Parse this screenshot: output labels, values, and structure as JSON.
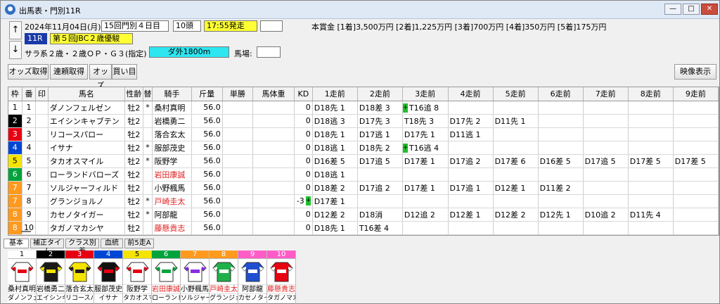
{
  "window": {
    "title": "出馬表・門別11R",
    "min": "—",
    "max": "□",
    "close": "✕"
  },
  "race": {
    "date": "2024年11月04日(月)",
    "meeting": "15回門別４日目",
    "heads": "10頭",
    "start_time": "17:55発走",
    "race_no": "11R",
    "race_name": "第５回JBC２歳優駿",
    "condition": "サラ系２歳・２歳ＯＰ・Ｇ３(指定)",
    "course": "ダ外1800m",
    "baba_label": "馬場:",
    "baba_value": "",
    "blank_box": "",
    "prize": "本賞金 [1着]3,500万円 [2着]1,225万円 [3着]700万円 [4着]350万円 [5着]175万円",
    "up_arrow": "↑",
    "down_arrow": "↓"
  },
  "toolbar": {
    "odds_fetch": "オッズ取得",
    "renpuku_fetch": "連頼取得",
    "odds": "オッズ",
    "buy": "買い目",
    "video": "映像表示"
  },
  "columns": [
    "枠",
    "番",
    "印",
    "馬名",
    "性齢",
    "替",
    "騎手",
    "斤量",
    "単勝",
    "馬体重",
    "KD",
    "1走前",
    "2走前",
    "3走前",
    "4走前",
    "5走前",
    "6走前",
    "7走前",
    "8走前",
    "9走前"
  ],
  "waku_colors": [
    "#ffffff",
    "#000000",
    "#e60012",
    "#0046d5",
    "#f4e400",
    "#00a33c",
    "#ff9a1f",
    "#ff9a1f",
    "#ff5cc8",
    "#ff5cc8"
  ],
  "waku_text_colors": [
    "#000000",
    "#ffffff",
    "#ffffff",
    "#ffffff",
    "#000000",
    "#ffffff",
    "#ffffff",
    "#ffffff",
    "#ffffff",
    "#ffffff"
  ],
  "rows": [
    {
      "waku": "1",
      "num": "1",
      "mark": "",
      "name": "ダノンフェルゼン",
      "sexage": "牡2",
      "change": "*",
      "jockey": "桑村真明",
      "jred": false,
      "weight": "56.0",
      "odds": "",
      "bw": "",
      "kd": "0",
      "kdicon": false,
      "past": [
        {
          "t": "D18先 1",
          "i": false
        },
        {
          "t": "D18差 3",
          "i": false
        },
        {
          "t": "T16追 8",
          "i": true
        },
        {
          "t": "",
          "i": false
        },
        {
          "t": "",
          "i": false
        },
        {
          "t": "",
          "i": false
        },
        {
          "t": "",
          "i": false
        },
        {
          "t": "",
          "i": false
        },
        {
          "t": "",
          "i": false
        }
      ]
    },
    {
      "waku": "2",
      "num": "2",
      "mark": "",
      "name": "エイシンキャブテン",
      "sexage": "牡2",
      "change": "",
      "jockey": "岩橋勇二",
      "jred": false,
      "weight": "56.0",
      "odds": "",
      "bw": "",
      "kd": "0",
      "kdicon": false,
      "past": [
        {
          "t": "D18逃 3",
          "i": false
        },
        {
          "t": "D17先 3",
          "i": false
        },
        {
          "t": "T18先 3",
          "i": false
        },
        {
          "t": "D17先 2",
          "i": false
        },
        {
          "t": "D11先 1",
          "i": false
        },
        {
          "t": "",
          "i": false
        },
        {
          "t": "",
          "i": false
        },
        {
          "t": "",
          "i": false
        },
        {
          "t": "",
          "i": false
        }
      ]
    },
    {
      "waku": "3",
      "num": "3",
      "mark": "",
      "name": "リコースパロー",
      "sexage": "牡2",
      "change": "",
      "jockey": "落合玄太",
      "jred": false,
      "weight": "56.0",
      "odds": "",
      "bw": "",
      "kd": "0",
      "kdicon": false,
      "past": [
        {
          "t": "D18先 1",
          "i": false
        },
        {
          "t": "D17逃 1",
          "i": false
        },
        {
          "t": "D17先 1",
          "i": false
        },
        {
          "t": "D11逃 1",
          "i": false
        },
        {
          "t": "",
          "i": false
        },
        {
          "t": "",
          "i": false
        },
        {
          "t": "",
          "i": false
        },
        {
          "t": "",
          "i": false
        },
        {
          "t": "",
          "i": false
        }
      ]
    },
    {
      "waku": "4",
      "num": "4",
      "mark": "",
      "name": "イサナ",
      "sexage": "牡2",
      "change": "*",
      "jockey": "服部茂史",
      "jred": false,
      "weight": "56.0",
      "odds": "",
      "bw": "",
      "kd": "0",
      "kdicon": false,
      "past": [
        {
          "t": "D18逃 1",
          "i": false
        },
        {
          "t": "D18先 2",
          "i": false
        },
        {
          "t": "T16逃 4",
          "i": true
        },
        {
          "t": "",
          "i": false
        },
        {
          "t": "",
          "i": false
        },
        {
          "t": "",
          "i": false
        },
        {
          "t": "",
          "i": false
        },
        {
          "t": "",
          "i": false
        },
        {
          "t": "",
          "i": false
        }
      ]
    },
    {
      "waku": "5",
      "num": "5",
      "mark": "",
      "name": "タカオスマイル",
      "sexage": "牡2",
      "change": "*",
      "jockey": "阪野学",
      "jred": false,
      "weight": "56.0",
      "odds": "",
      "bw": "",
      "kd": "0",
      "kdicon": false,
      "past": [
        {
          "t": "D16差 5",
          "i": false
        },
        {
          "t": "D17追 5",
          "i": false
        },
        {
          "t": "D17差 1",
          "i": false
        },
        {
          "t": "D17追 2",
          "i": false
        },
        {
          "t": "D17差 6",
          "i": false
        },
        {
          "t": "D16差 5",
          "i": false
        },
        {
          "t": "D17追 5",
          "i": false
        },
        {
          "t": "D17差 5",
          "i": false
        },
        {
          "t": "D17差 5",
          "i": false
        }
      ]
    },
    {
      "waku": "6",
      "num": "6",
      "mark": "",
      "name": "ローランドバローズ",
      "sexage": "牡2",
      "change": "",
      "jockey": "岩田康誠",
      "jred": true,
      "weight": "56.0",
      "odds": "",
      "bw": "",
      "kd": "0",
      "kdicon": false,
      "past": [
        {
          "t": "D18逃 1",
          "i": false
        },
        {
          "t": "",
          "i": false
        },
        {
          "t": "",
          "i": false
        },
        {
          "t": "",
          "i": false
        },
        {
          "t": "",
          "i": false
        },
        {
          "t": "",
          "i": false
        },
        {
          "t": "",
          "i": false
        },
        {
          "t": "",
          "i": false
        },
        {
          "t": "",
          "i": false
        }
      ]
    },
    {
      "waku": "7",
      "num": "7",
      "mark": "",
      "name": "ソルジャーフィルド",
      "sexage": "牡2",
      "change": "",
      "jockey": "小野楓馬",
      "jred": false,
      "weight": "56.0",
      "odds": "",
      "bw": "",
      "kd": "0",
      "kdicon": false,
      "past": [
        {
          "t": "D18差 2",
          "i": false
        },
        {
          "t": "D17追 2",
          "i": false
        },
        {
          "t": "D17差 1",
          "i": false
        },
        {
          "t": "D17追 1",
          "i": false
        },
        {
          "t": "D12差 1",
          "i": false
        },
        {
          "t": "D11差 2",
          "i": false
        },
        {
          "t": "",
          "i": false
        },
        {
          "t": "",
          "i": false
        },
        {
          "t": "",
          "i": false
        }
      ]
    },
    {
      "waku": "7",
      "num": "8",
      "mark": "",
      "name": "グランジョルノ",
      "sexage": "牡2",
      "change": "*",
      "jockey": "戸崎圭太",
      "jred": true,
      "weight": "56.0",
      "odds": "",
      "bw": "",
      "kd": "-3",
      "kdicon": true,
      "past": [
        {
          "t": "D17差 1",
          "i": false
        },
        {
          "t": "",
          "i": false
        },
        {
          "t": "",
          "i": false
        },
        {
          "t": "",
          "i": false
        },
        {
          "t": "",
          "i": false
        },
        {
          "t": "",
          "i": false
        },
        {
          "t": "",
          "i": false
        },
        {
          "t": "",
          "i": false
        },
        {
          "t": "",
          "i": false
        }
      ]
    },
    {
      "waku": "8",
      "num": "9",
      "mark": "",
      "name": "カセノタイガー",
      "sexage": "牡2",
      "change": "*",
      "jockey": "阿部龍",
      "jred": false,
      "weight": "56.0",
      "odds": "",
      "bw": "",
      "kd": "0",
      "kdicon": false,
      "past": [
        {
          "t": "D12差 2",
          "i": false
        },
        {
          "t": "D18消",
          "i": false
        },
        {
          "t": "D12追 2",
          "i": false
        },
        {
          "t": "D12差 1",
          "i": false
        },
        {
          "t": "D12差 2",
          "i": false
        },
        {
          "t": "D12先 1",
          "i": false
        },
        {
          "t": "D10追 2",
          "i": false
        },
        {
          "t": "D11先 4",
          "i": false
        },
        {
          "t": "",
          "i": false
        }
      ]
    },
    {
      "waku": "8",
      "num": "10",
      "mark": "",
      "name": "タガノマカシヤ",
      "sexage": "牡2",
      "change": "",
      "jockey": "藤懸貴志",
      "jred": true,
      "weight": "56.0",
      "odds": "",
      "bw": "",
      "kd": "0",
      "kdicon": false,
      "past": [
        {
          "t": "D18先 1",
          "i": false
        },
        {
          "t": "T16差 4",
          "i": false
        },
        {
          "t": "",
          "i": false
        },
        {
          "t": "",
          "i": false
        },
        {
          "t": "",
          "i": false
        },
        {
          "t": "",
          "i": false
        },
        {
          "t": "",
          "i": false
        },
        {
          "t": "",
          "i": false
        },
        {
          "t": "",
          "i": false
        }
      ]
    }
  ],
  "tabs": [
    "基本",
    "補正タイム",
    "クラス別着",
    "血統",
    "前5走A"
  ],
  "silks": [
    {
      "num": "1",
      "jockey": "桑村真明",
      "horse": "ダノンフェル",
      "body": "#ffffff",
      "pattern": "#e60012",
      "jred": false
    },
    {
      "num": "2",
      "jockey": "岩橋勇二",
      "horse": "エイシンキ",
      "body": "#1a1a1a",
      "pattern": "#f4e400",
      "jred": false
    },
    {
      "num": "3",
      "jockey": "落合玄太",
      "horse": "リコースパ",
      "body": "#f4e400",
      "pattern": "#1a1a1a",
      "jred": false
    },
    {
      "num": "4",
      "jockey": "服部茂史",
      "horse": "イサナ",
      "body": "#111111",
      "pattern": "#e60012",
      "jred": false
    },
    {
      "num": "5",
      "jockey": "阪野学",
      "horse": "タカオスマ",
      "body": "#ffffff",
      "pattern": "#e60012",
      "jred": false
    },
    {
      "num": "6",
      "jockey": "岩田康誠",
      "horse": "ローランド",
      "body": "#ffffff",
      "pattern": "#00a33c",
      "jred": true
    },
    {
      "num": "7",
      "jockey": "小野楓馬",
      "horse": "ソルジャー",
      "body": "#ffffff",
      "pattern": "#8a2be2",
      "jred": false
    },
    {
      "num": "8",
      "jockey": "戸崎圭太",
      "horse": "グランジョ",
      "body": "#1fb04a",
      "pattern": "#ffffff",
      "jred": true
    },
    {
      "num": "9",
      "jockey": "阿部龍",
      "horse": "カセノタイ",
      "body": "#1f4fd0",
      "pattern": "#ffffff",
      "jred": false
    },
    {
      "num": "10",
      "jockey": "藤懸貴志",
      "horse": "タガノマカ",
      "body": "#e60012",
      "pattern": "#ffffff",
      "jred": true
    }
  ]
}
